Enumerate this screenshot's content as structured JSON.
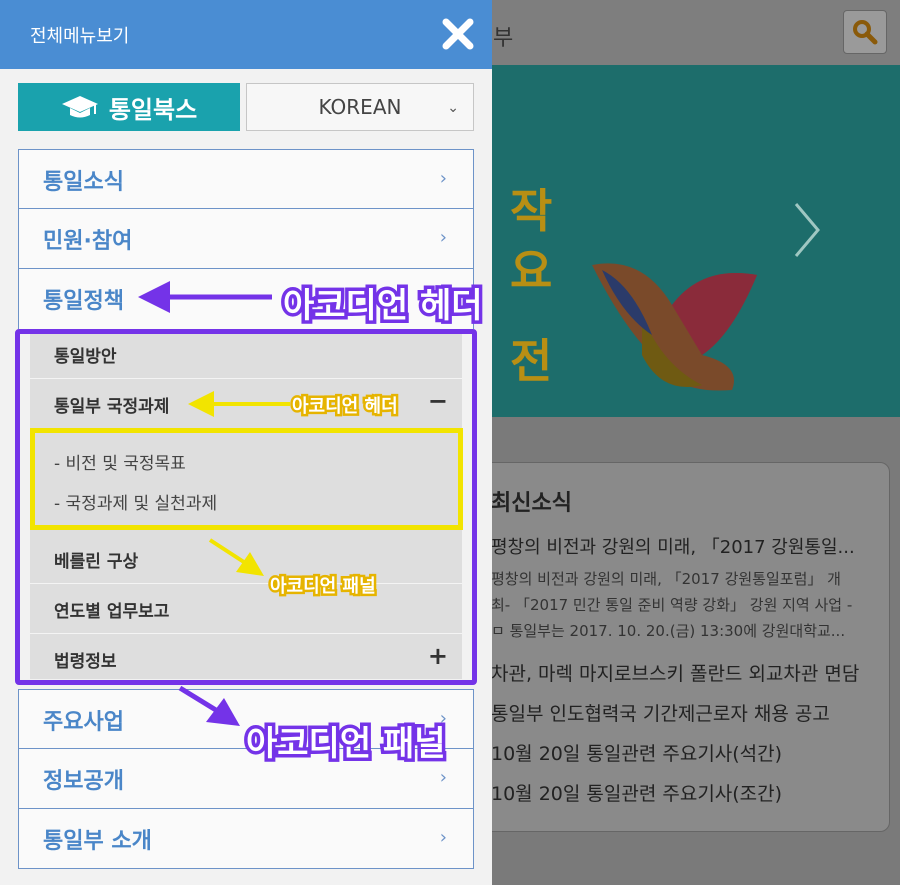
{
  "drawer": {
    "title": "전체메뉴보기",
    "books_label": "통일북스",
    "language": "KOREAN"
  },
  "menu": [
    {
      "label": "통일소식"
    },
    {
      "label": "민원·참여"
    },
    {
      "label": "통일정책"
    },
    {
      "label": "주요사업"
    },
    {
      "label": "정보공개"
    },
    {
      "label": "통일부 소개"
    }
  ],
  "submenu": {
    "items": [
      {
        "label": "통일방안"
      },
      {
        "label": "통일부 국정과제",
        "sign": "−"
      },
      {
        "label": "베를린 구상"
      },
      {
        "label": "연도별 업무보고"
      },
      {
        "label": "법령정보",
        "sign": "+"
      }
    ],
    "children": [
      "- 비전 및 국정목표",
      "- 국정과제 및 실천과제"
    ]
  },
  "annotations": {
    "accordion_header_big": "아코디언 헤더",
    "accordion_header_small": "아코디언 헤더",
    "accordion_panel_small": "아코디언 패널",
    "accordion_panel_big": "아코디언 패널"
  },
  "background": {
    "header_text": "부",
    "banner_chars": [
      "작",
      "요",
      "전"
    ],
    "news_title": "최신소식",
    "news_headline": "평창의 비전과 강원의 미래, 「2017 강원통일...",
    "news_lines": [
      "평창의 비전과 강원의 미래, 「2017 강원통일포럼」 개",
      "최- 「2017 민간 통일 준비 역량 강화」 강원 지역 사업 -",
      "ㅁ 통일부는 2017. 10. 20.(금) 13:30에 강원대학교..."
    ],
    "news_list": [
      "차관, 마렉 마지로브스키 폴란드 외교차관 면담",
      "통일부 인도협력국 기간제근로자 채용 공고",
      "10월 20일 통일관련 주요기사(석간)",
      "10월 20일 통일관련 주요기사(조간)"
    ]
  },
  "colors": {
    "header_blue": "#4a8dd3",
    "books_teal": "#1aa2ad",
    "menu_text_blue": "#4a86c8",
    "annotation_purple": "#7433e8",
    "annotation_yellow": "#f2e400"
  }
}
